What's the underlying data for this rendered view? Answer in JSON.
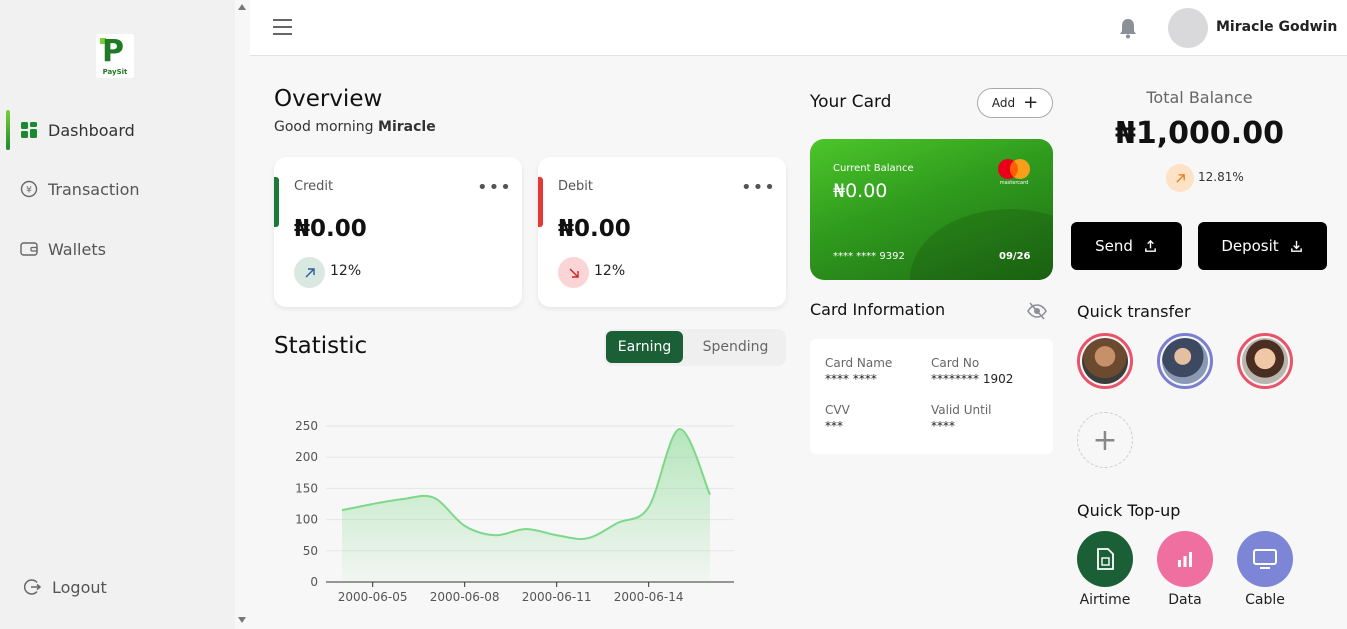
{
  "app": {
    "brand": "PaySit",
    "logo_letter": "P"
  },
  "sidebar": {
    "items": [
      {
        "label": "Dashboard",
        "icon": "grid-icon"
      },
      {
        "label": "Transaction",
        "icon": "exchange-icon"
      },
      {
        "label": "Wallets",
        "icon": "wallet-icon"
      }
    ],
    "logout": "Logout"
  },
  "topbar": {
    "user_name": "Miracle Godwin"
  },
  "overview": {
    "title": "Overview",
    "greeting_prefix": "Good morning",
    "greeting_name": "Miracle",
    "credit": {
      "label": "Credit",
      "amount": "₦0.00",
      "change": "12%",
      "accent": "#1b7a3a"
    },
    "debit": {
      "label": "Debit",
      "amount": "₦0.00",
      "change": "12%",
      "accent": "#e53935"
    },
    "more": "•••"
  },
  "statistic": {
    "title": "Statistic",
    "tabs": [
      "Earning",
      "Spending"
    ],
    "active_tab": "Earning"
  },
  "chart_data": {
    "type": "area",
    "x": [
      "2000-06-04",
      "2000-06-05",
      "2000-06-06",
      "2000-06-07",
      "2000-06-08",
      "2000-06-09",
      "2000-06-10",
      "2000-06-11",
      "2000-06-12",
      "2000-06-13",
      "2000-06-14",
      "2000-06-15",
      "2000-06-16"
    ],
    "series": [
      {
        "values": [
          115,
          125,
          133,
          135,
          90,
          75,
          85,
          75,
          70,
          95,
          120,
          245,
          140
        ]
      }
    ],
    "x_ticks": [
      "2000-06-05",
      "2000-06-08",
      "2000-06-11",
      "2000-06-14"
    ],
    "y_ticks": [
      0,
      50,
      100,
      150,
      200,
      250
    ],
    "ylim": [
      0,
      250
    ],
    "grid": true,
    "color": "#7dd88a"
  },
  "your_card": {
    "title": "Your Card",
    "add_label": "Add",
    "balance_label": "Current Balance",
    "balance": "₦0.00",
    "brand_text": "mastercard",
    "number": "**** **** 9392",
    "expiry": "09/26"
  },
  "card_info": {
    "title": "Card Information",
    "name_label": "Card Name",
    "name_value": "**** ****",
    "no_label": "Card No",
    "no_value": "******** 1902",
    "cvv_label": "CVV",
    "cvv_value": "***",
    "valid_label": "Valid Until",
    "valid_value": "****"
  },
  "balance": {
    "label": "Total Balance",
    "amount": "₦1,000.00",
    "change": "12.81%",
    "send": "Send",
    "deposit": "Deposit"
  },
  "quick_transfer": {
    "title": "Quick transfer",
    "add": "+"
  },
  "quick_topup": {
    "title": "Quick Top-up",
    "items": [
      {
        "label": "Airtime",
        "color": "#1a5f35",
        "icon": "sim-card-icon"
      },
      {
        "label": "Data",
        "color": "#ef6fa0",
        "icon": "bar-chart-icon"
      },
      {
        "label": "Cable",
        "color": "#7d86d6",
        "icon": "tv-icon"
      }
    ]
  }
}
